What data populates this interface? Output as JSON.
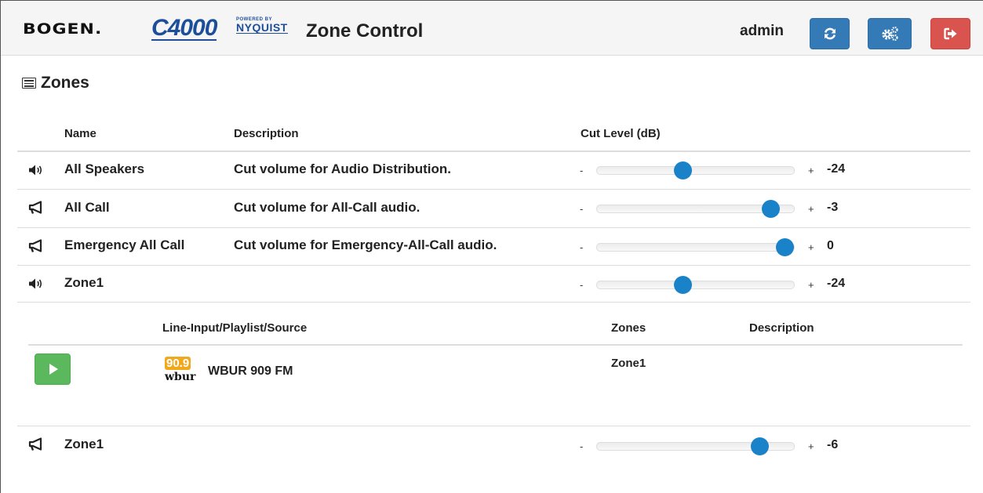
{
  "header": {
    "brand_bogen": "BOGEN.",
    "brand_c4000": "C4000",
    "brand_powered": "POWERED BY",
    "brand_nyquist": "NYQUIST",
    "title": "Zone Control",
    "username": "admin",
    "icons": {
      "refresh": "refresh-icon",
      "settings": "gears-icon",
      "logout": "sign-out-icon"
    }
  },
  "zones_section": {
    "title": "Zones",
    "columns": {
      "name": "Name",
      "description": "Description",
      "cut_level": "Cut Level (dB)"
    },
    "minus_label": "-",
    "plus_label": "+",
    "rows": [
      {
        "icon": "speaker-icon",
        "name": "All Speakers",
        "description": "Cut volume for Audio Distribution.",
        "level": "-24",
        "slider_fraction": 0.43
      },
      {
        "icon": "bullhorn-icon",
        "name": "All Call",
        "description": "Cut volume for All-Call audio.",
        "level": "-3",
        "slider_fraction": 0.92
      },
      {
        "icon": "bullhorn-icon",
        "name": "Emergency All Call",
        "description": "Cut volume for Emergency-All-Call audio.",
        "level": "0",
        "slider_fraction": 1.0
      },
      {
        "icon": "speaker-icon",
        "name": "Zone1",
        "description": "",
        "level": "-24",
        "slider_fraction": 0.43
      }
    ]
  },
  "sources_table": {
    "columns": {
      "source": "Line-Input/Playlist/Source",
      "zones": "Zones",
      "description": "Description"
    },
    "rows": [
      {
        "logo_freq": "90.9",
        "logo_name": "wbur",
        "name": "WBUR 909 FM",
        "zones": "Zone1",
        "description": ""
      }
    ]
  },
  "paging_zone": {
    "icon": "bullhorn-icon",
    "name": "Zone1",
    "level": "-6",
    "slider_fraction": 0.86
  },
  "colors": {
    "primary": "#337ab7",
    "danger": "#d9534f",
    "success": "#5cb85c",
    "slider_thumb": "#1a82c9",
    "brand_blue": "#1c4e9a",
    "wbur_orange": "#f0a81c"
  }
}
